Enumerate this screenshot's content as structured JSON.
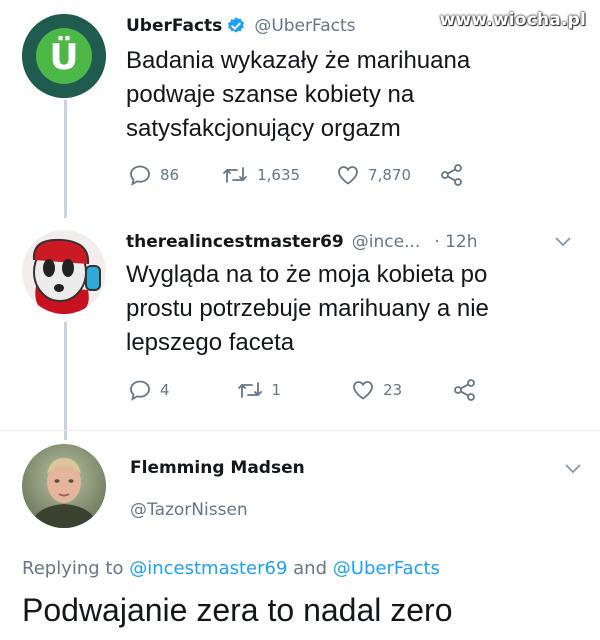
{
  "watermark": "www.wiocha.pl",
  "tweets": [
    {
      "name": "UberFacts",
      "verified": true,
      "handle": "@UberFacts",
      "text_lines": [
        "Badania wykazały że marihuana",
        "podwaje szanse kobiety na",
        "satysfakcjonujący orgazm"
      ],
      "replies": "86",
      "retweets": "1,635",
      "likes": "7,870",
      "avatar_letter": "Ü"
    },
    {
      "name": "therealincestmaster69",
      "handle": "@ince...",
      "time": "· 12h",
      "text_lines": [
        "Wygląda na to że moja kobieta po",
        "prostu potrzebuje marihuany a nie",
        "lepszego faceta"
      ],
      "replies": "4",
      "retweets": "1",
      "likes": "23"
    }
  ],
  "reply": {
    "name": "Flemming Madsen",
    "handle": "@TazorNissen",
    "replying_label": "Replying to",
    "mention_1": "@incestmaster69",
    "and_label": "and",
    "mention_2": "@UberFacts",
    "text": "Podwajanie zera to nadal zero"
  },
  "colors": {
    "accent": "#1da1f2",
    "muted": "#657786",
    "uber_green": "#4db847",
    "uber_dark": "#1f5c4f"
  }
}
